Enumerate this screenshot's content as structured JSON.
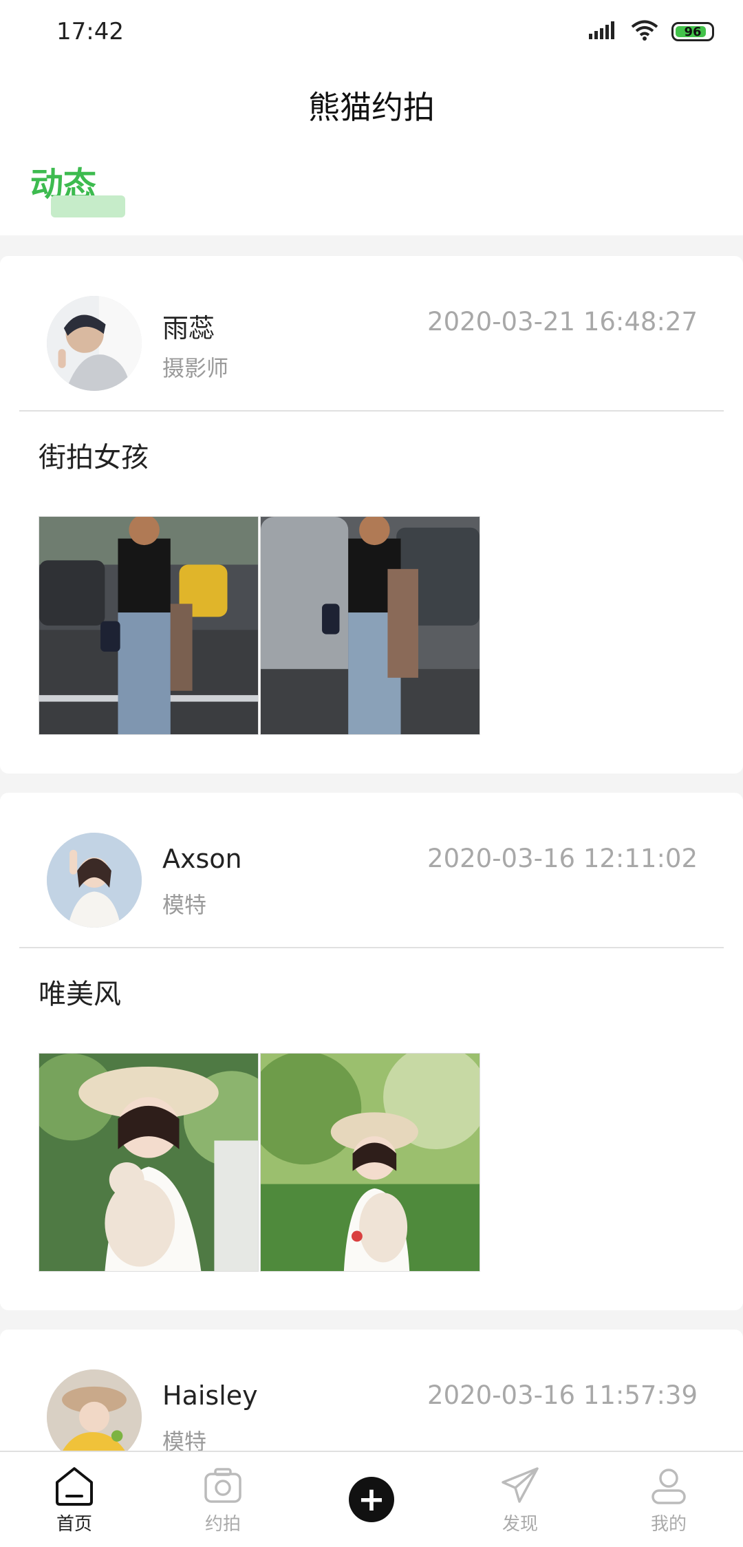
{
  "status_bar": {
    "time": "17:42",
    "battery": "96",
    "battery_color": "#43c24a"
  },
  "header": {
    "title": "熊猫约拍",
    "tabs": [
      {
        "label": "动态",
        "active": true
      }
    ],
    "accent": "#3dbb4f"
  },
  "feed": [
    {
      "user": "雨蕊",
      "role": "摄影师",
      "time": "2020-03-21 16:48:27",
      "text": "街拍女孩",
      "photos": 2
    },
    {
      "user": "Axson",
      "role": "模特",
      "time": "2020-03-16 12:11:02",
      "text": "唯美风",
      "photos": 2
    },
    {
      "user": "Haisley",
      "role": "模特",
      "time": "2020-03-16 11:57:39",
      "text": "",
      "photos": 0
    }
  ],
  "bottom_nav": [
    {
      "label": "首页",
      "icon": "home-icon",
      "active": true
    },
    {
      "label": "约拍",
      "icon": "camera-icon",
      "active": false
    },
    {
      "label": "",
      "icon": "plus-icon",
      "active": false
    },
    {
      "label": "发现",
      "icon": "paper-plane-icon",
      "active": false
    },
    {
      "label": "我的",
      "icon": "user-icon",
      "active": false
    }
  ]
}
